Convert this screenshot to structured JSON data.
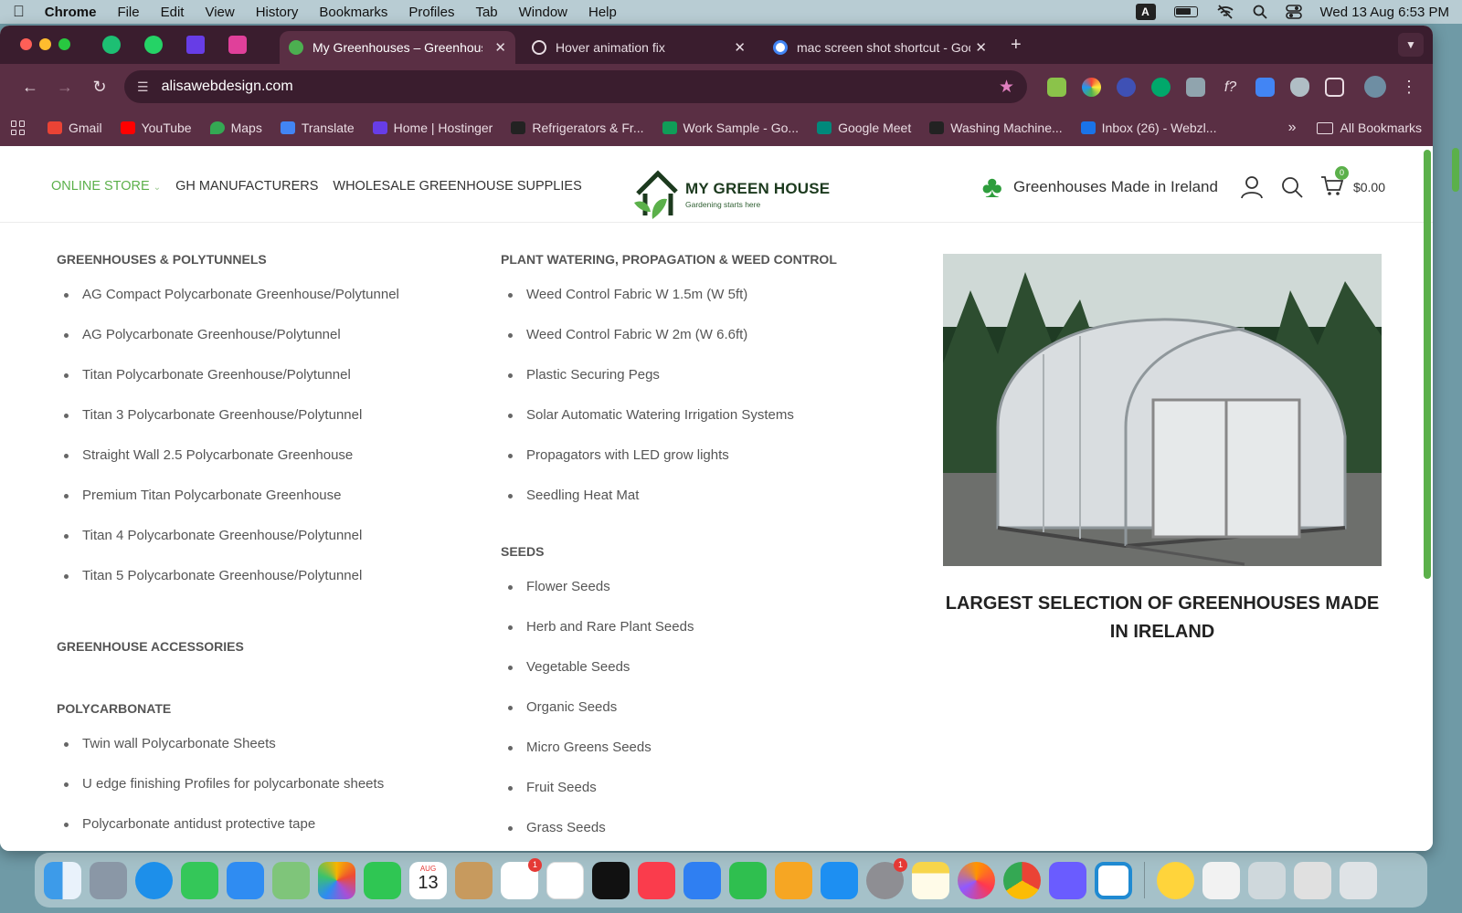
{
  "menubar": {
    "app": "Chrome",
    "items": [
      "File",
      "Edit",
      "View",
      "History",
      "Bookmarks",
      "Profiles",
      "Tab",
      "Window",
      "Help"
    ],
    "input_source": "A",
    "datetime": "Wed 13 Aug  6:53 PM"
  },
  "tabs": [
    {
      "label": "My Greenhouses – Greenhouses",
      "active": true
    },
    {
      "label": "Hover animation fix",
      "active": false
    },
    {
      "label": "mac screen shot shortcut - Google",
      "active": false
    }
  ],
  "toolbar": {
    "url": "alisawebdesign.com"
  },
  "bookmarks": [
    {
      "label": "Gmail",
      "color": "#ea4335"
    },
    {
      "label": "YouTube",
      "color": "#ff0000"
    },
    {
      "label": "Maps",
      "color": "#34a853"
    },
    {
      "label": "Translate",
      "color": "#4285f4"
    },
    {
      "label": "Home | Hostinger",
      "color": "#673de6"
    },
    {
      "label": "Refrigerators & Fr...",
      "color": "#222222"
    },
    {
      "label": "Work Sample - Go...",
      "color": "#0f9d58"
    },
    {
      "label": "Google Meet",
      "color": "#00897b"
    },
    {
      "label": "Washing Machine...",
      "color": "#222222"
    },
    {
      "label": "Inbox (26) - Webzl...",
      "color": "#1a73e8"
    }
  ],
  "bookmarks_all": "All Bookmarks",
  "site": {
    "nav": {
      "online_store": "ONLINE STORE",
      "manufacturers": "GH MANUFACTURERS",
      "wholesale": "WHOLESALE GREENHOUSE SUPPLIES"
    },
    "logo": {
      "name": "MY GREEN HOUSE",
      "tagline": "Gardening starts here"
    },
    "made_in": "Greenhouses Made in Ireland",
    "cart_count": "0",
    "cart_total": "$0.00",
    "brand_color": "#5bb04a"
  },
  "menu": {
    "col1": {
      "greenhouses_heading": "GREENHOUSES & POLYTUNNELS",
      "greenhouses": [
        "AG Compact Polycarbonate Greenhouse/Polytunnel",
        "AG Polycarbonate Greenhouse/Polytunnel",
        "Titan Polycarbonate Greenhouse/Polytunnel",
        "Titan 3 Polycarbonate Greenhouse/Polytunnel",
        "Straight Wall 2.5 Polycarbonate Greenhouse",
        "Premium Titan Polycarbonate Greenhouse",
        "Titan 4 Polycarbonate Greenhouse/Polytunnel",
        "Titan 5 Polycarbonate Greenhouse/Polytunnel"
      ],
      "accessories_heading": "GREENHOUSE ACCESSORIES",
      "polycarbonate_heading": "POLYCARBONATE",
      "polycarbonate": [
        "Twin wall Polycarbonate Sheets",
        "U edge finishing Profiles for polycarbonate sheets",
        "Polycarbonate antidust protective tape"
      ]
    },
    "col2": {
      "watering_heading": "PLANT WATERING, PROPAGATION & WEED CONTROL",
      "watering": [
        "Weed Control Fabric W 1.5m (W 5ft)",
        "Weed Control Fabric W 2m (W 6.6ft)",
        "Plastic Securing Pegs",
        "Solar Automatic Watering Irrigation Systems",
        "Propagators with LED grow lights",
        "Seedling Heat Mat"
      ],
      "seeds_heading": "SEEDS",
      "seeds": [
        "Flower Seeds",
        "Herb and Rare Plant Seeds",
        "Vegetable Seeds",
        "Organic Seeds",
        "Micro Greens Seeds",
        "Fruit Seeds",
        "Grass Seeds"
      ]
    },
    "promo_text": "LARGEST SELECTION OF GREENHOUSES MADE IN IRELAND"
  },
  "dock": {
    "calendar_month": "AUG",
    "calendar_day": "13",
    "reminders_badge": "1",
    "settings_badge": "1"
  }
}
